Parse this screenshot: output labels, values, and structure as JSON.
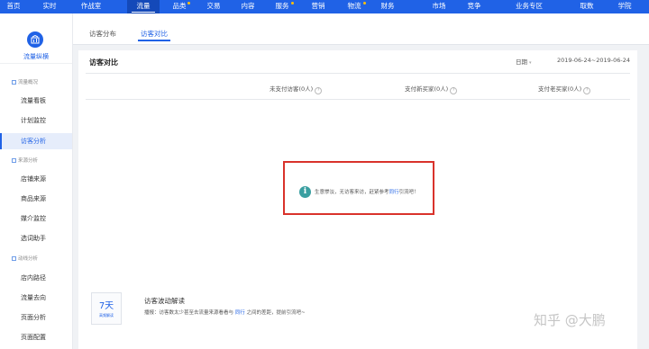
{
  "topnav": {
    "items": [
      {
        "label": "首页"
      },
      {
        "label": "实时"
      },
      {
        "label": "作战室"
      },
      {
        "label": "流量"
      },
      {
        "label": "品类"
      },
      {
        "label": "交易"
      },
      {
        "label": "内容"
      },
      {
        "label": "服务"
      },
      {
        "label": "营销"
      },
      {
        "label": "物流"
      },
      {
        "label": "财务"
      },
      {
        "label": "市场"
      },
      {
        "label": "竞争"
      },
      {
        "label": "业务专区"
      },
      {
        "label": "取数"
      },
      {
        "label": "学院"
      }
    ],
    "active": "流量"
  },
  "sidebar": {
    "brand": "流量纵横",
    "groups": [
      {
        "title": "流量概况",
        "items": [
          "流量看板",
          "计划监控",
          "访客分析"
        ]
      },
      {
        "title": "来源分析",
        "items": [
          "店铺来源",
          "商品来源",
          "媒介监控",
          "选词助手"
        ]
      },
      {
        "title": "动线分析",
        "items": [
          "店内路径",
          "流量去向",
          "页面分析",
          "页面配置"
        ]
      }
    ],
    "active_item": "访客分析"
  },
  "tabs": {
    "items": [
      "访客分布",
      "访客对比"
    ],
    "active": "访客对比"
  },
  "panel": {
    "title": "访客对比",
    "date_label": "日期",
    "date_range": "2019-06-24~2019-06-24",
    "columns": [
      "未支付访客(0人)",
      "支付新买家(0人)",
      "支付老买家(0人)"
    ],
    "qmark": "?"
  },
  "empty_state": {
    "icon": "i",
    "text_before": "生意惨淡，无访客来访，赶紧参考",
    "link": "同行",
    "text_after": "引流吧！"
  },
  "interpretation": {
    "badge_number": "7天",
    "badge_sub": "高频解读",
    "title": "访客波动解读",
    "text_before": "播报：访客数太少甚至去流量来源看看与",
    "link": "同行",
    "text_after": "之间的差距，提前引流吧~"
  },
  "watermark": "知乎 @大鹏",
  "colors": {
    "primary": "#2062e6",
    "highlight": "#d9322b",
    "info": "#3a9fa1"
  }
}
